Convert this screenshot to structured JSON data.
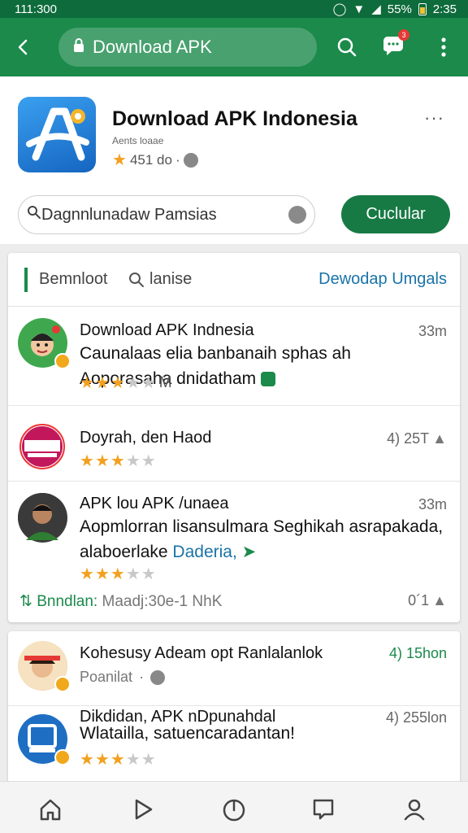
{
  "status_bar": {
    "time": "111:300",
    "battery": "55%",
    "clock": "2:35"
  },
  "toolbar": {
    "url": "Download APK",
    "notification_count": "3"
  },
  "app": {
    "title": "Download APK Indonesia",
    "subtitle": "Aents loaae",
    "rating": "451 do",
    "search_value": "Dagnnlunadaw  Pamsias",
    "primary_button": "Cuclular"
  },
  "tabs": {
    "tab1": "Bemnloot",
    "tab2": "lanise",
    "link": "Dewodap Umgals"
  },
  "items": [
    {
      "title": "Download APK Indnesia",
      "meta": "33m",
      "desc": "Caunalaas elia banbanaih sphas ah Aoporasaha dnidatham",
      "stars": 3,
      "extra": "M"
    },
    {
      "title": "Doyrah, den Haod",
      "meta": "4) 25T",
      "stars": 3
    },
    {
      "title": "APK lou APK /unaea",
      "meta": "33m",
      "desc": "Aopmlorran lisansulmara Seghikah asrapakada, alaboerlake ",
      "desc_link": "Daderia,",
      "stars": 3,
      "footer_green": "Bnndlan:",
      "footer_grey": "Maadj:30e-1 NhK",
      "footer_meta": "0´1"
    }
  ],
  "items2": [
    {
      "title": "Kohesusy Adeam opt Ranlalanlok",
      "meta": "4) 15hon",
      "sub": "Poanilat"
    },
    {
      "title": "Dikdidan, APK nDpunahdal",
      "meta": "4) 255lon",
      "desc": "Wlatailla, satuencaradantan!",
      "stars": 3
    }
  ],
  "colors": {
    "brand": "#1b8a4b",
    "status": "#0e6b3b",
    "link": "#1a73a8",
    "star": "#f2a020"
  },
  "icons": [
    "back-arrow-icon",
    "lock-icon",
    "search-icon",
    "chat-icon",
    "more-vert-icon",
    "home-icon",
    "play-icon",
    "power-icon",
    "message-icon",
    "person-icon"
  ]
}
